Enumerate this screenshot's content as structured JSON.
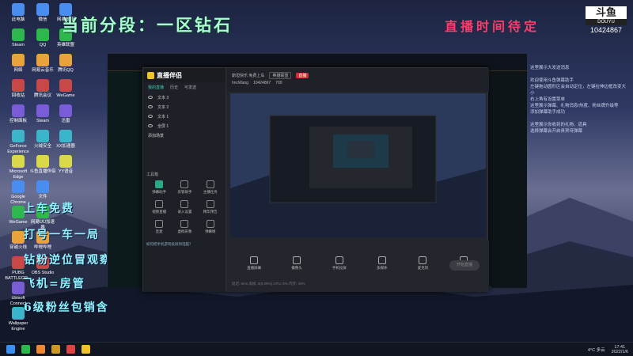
{
  "desktop": {
    "icons_col1": [
      "此电脑",
      "Steam",
      "网络",
      "回收站",
      "控制面板",
      "GeForce Experience",
      "Microsoft Edge",
      "Google Chrome",
      "WeGame",
      "穿越火线",
      "PUBG BATTLEGR...",
      "Ubisoft Connect",
      "Wallpaper Engine"
    ],
    "icons_col2": [
      "微信",
      "QQ",
      "网易云音乐",
      "腾讯会议",
      "Steam",
      "火绒安全",
      "斗鱼直播伴侣",
      "文件",
      "网易UU加速器",
      "哔哩哔哩",
      "OBS Studio"
    ],
    "icons_col3": [
      "网易邮箱",
      "英雄联盟",
      "腾讯QQ",
      "WeGame",
      "迅雷",
      "XX加速器",
      "YY语音"
    ]
  },
  "overlay": {
    "rank_text": "当前分段：一区钻石",
    "red_text": "直播时间待定",
    "lines": [
      "上车免费",
      "打号一车一局",
      "钻粉逆位冒观察",
      "飞机=房管",
      "6级粉丝包销含"
    ]
  },
  "logo": {
    "top": "斗鱼",
    "sub": "DOUYU",
    "room_id": "10424867"
  },
  "app": {
    "title": "直播伴侣",
    "tabs": [
      "我的直播",
      "历史",
      "可发送"
    ],
    "scenes": [
      "文本 3",
      "文本 2",
      "文本 1",
      "全屏 1"
    ],
    "add_scene": "添加场景",
    "tools_header": "工具箱",
    "tools": [
      {
        "label": "弹幕助手",
        "active": true
      },
      {
        "label": "房管助手",
        "active": false
      },
      {
        "label": "主播任务",
        "active": false
      },
      {
        "label": "视频直播",
        "active": false
      },
      {
        "label": "录入设置",
        "active": false
      },
      {
        "label": "精华预告",
        "active": false
      },
      {
        "label": "连麦",
        "active": false
      },
      {
        "label": "虚拟形象",
        "active": false
      },
      {
        "label": "弹幕姬",
        "active": false
      }
    ],
    "hint": "如何把手机游戏投屏到电脑？",
    "room_title": "斯坦快乐 免费上车",
    "room_category": "英雄联盟",
    "live_label": "直播",
    "host_name": "hncWang",
    "host_id": "10424867",
    "viewers": "700",
    "bottom_tools": [
      "直播屏幕",
      "摄像头",
      "手机投屏",
      "多媒体",
      "麦克风",
      "扬声器"
    ],
    "start_button": "开始直播",
    "stats": "延迟: 0ms  丢帧: 0(0.00%)  CPU: 8%  内存: 40%"
  },
  "right_panel": {
    "lines": [
      "这里展示大发送消息",
      "",
      "欢迎使用斗鱼弹幕助手",
      "左键拖动圆形区会自动定位，左键拉伸边框改变大小",
      "右上角有设置菜单",
      "这里展示弹幕、礼物消息/热度、粉丝牌升级等",
      "添加弹幕助手成功",
      "",
      "这里展示你收到的礼物、道具",
      "选择弹幕会开启贵宾待弹幕"
    ]
  },
  "taskbar": {
    "weather": "4°C 多云",
    "time": "17:41",
    "date": "2022/1/6"
  },
  "colors": {
    "accent": "#2aa887",
    "live_red": "#cc3333",
    "overlay_green": "#a8ffd0",
    "overlay_cyan": "#8ef5ff"
  }
}
